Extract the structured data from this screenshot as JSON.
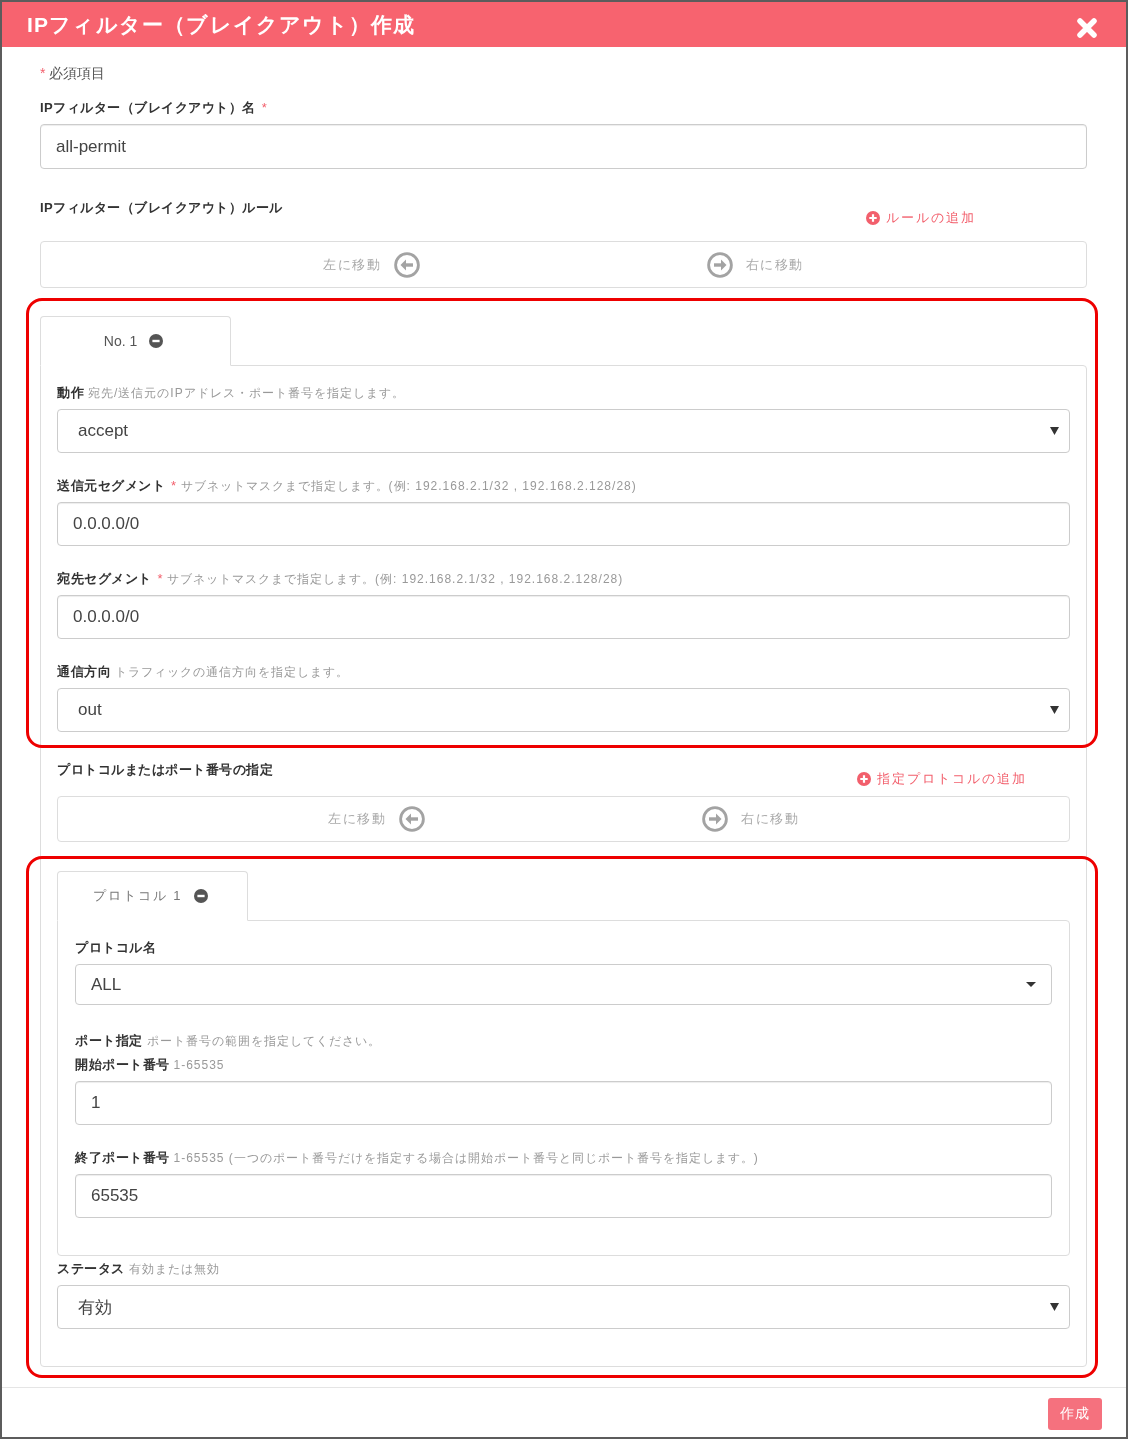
{
  "dialog": {
    "title": "IPフィルター（ブレイクアウト）作成"
  },
  "required_note": {
    "mark": "*",
    "text": "必須項目"
  },
  "name_field": {
    "label": "IPフィルター（ブレイクアウト）名",
    "mark": "*",
    "value": "all-permit"
  },
  "rules": {
    "label": "IPフィルター（ブレイクアウト）ルール",
    "add_link": "ルールの追加",
    "move_left": "左に移動",
    "move_right": "右に移動",
    "tabs": [
      {
        "label": "No. 1",
        "selected": true
      }
    ],
    "fields": [
      {
        "kind": "select",
        "label": "動作",
        "hint": "宛先/送信元のIPアドレス・ポート番号を指定します。",
        "value": "accept"
      },
      {
        "kind": "text",
        "label": "送信元セグメント",
        "mark": "*",
        "hint": "サブネットマスクまで指定します。(例: 192.168.2.1/32 , 192.168.2.128/28)",
        "value": "0.0.0.0/0"
      },
      {
        "kind": "text",
        "label": "宛先セグメント",
        "mark": "*",
        "hint": "サブネットマスクまで指定します。(例: 192.168.2.1/32 , 192.168.2.128/28)",
        "value": "0.0.0.0/0"
      },
      {
        "kind": "select",
        "label": "通信方向",
        "hint": "トラフィックの通信方向を指定します。",
        "value": "out"
      }
    ],
    "protocols": {
      "label": "プロトコルまたはポート番号の指定",
      "add_link": "指定プロトコルの追加",
      "move_left": "左に移動",
      "move_right": "右に移動",
      "tabs": [
        {
          "label": "プロトコル 1",
          "selected": true
        }
      ],
      "fields": [
        {
          "kind": "dropdown",
          "label": "プロトコル名",
          "value": "ALL"
        },
        {
          "kind": "heading",
          "label": "ポート指定",
          "hint": "ポート番号の範囲を指定してください。"
        },
        {
          "kind": "text",
          "label": "開始ポート番号",
          "hint": "1-65535",
          "value": "1"
        },
        {
          "kind": "text",
          "label": "終了ポート番号",
          "hint": "1-65535 (一つのポート番号だけを指定する場合は開始ポート番号と同じポート番号を指定します。)",
          "value": "65535"
        }
      ]
    },
    "status_field": {
      "kind": "select",
      "label": "ステータス",
      "hint": "有効または無効",
      "value": "有効"
    }
  },
  "submit": "作成"
}
